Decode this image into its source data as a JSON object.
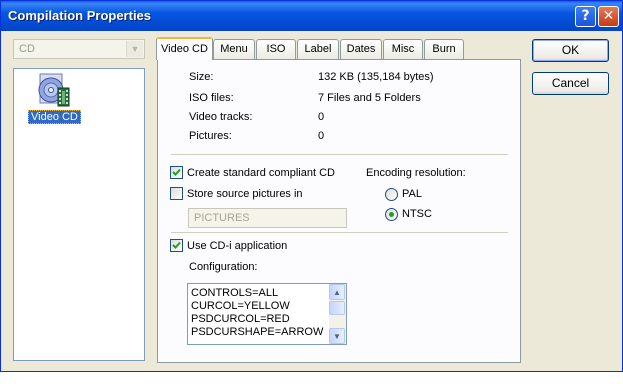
{
  "window": {
    "title": "Compilation Properties"
  },
  "titlebar": {
    "help_icon": "?",
    "close_icon": "✕"
  },
  "left": {
    "combo_value": "CD",
    "selected_item_label": "Video CD",
    "selected_item_icon": "video-cd-icon"
  },
  "tabs": [
    {
      "label": "Video CD",
      "active": true
    },
    {
      "label": "Menu"
    },
    {
      "label": "ISO"
    },
    {
      "label": "Label"
    },
    {
      "label": "Dates"
    },
    {
      "label": "Misc"
    },
    {
      "label": "Burn"
    }
  ],
  "info": [
    {
      "label": "Size:",
      "value": "132 KB (135,184 bytes)"
    },
    {
      "label": "ISO files:",
      "value": "7 Files and 5 Folders"
    },
    {
      "label": "Video tracks:",
      "value": "0"
    },
    {
      "label": "Pictures:",
      "value": "0"
    }
  ],
  "options": {
    "create_standard": {
      "label": "Create standard compliant CD",
      "checked": true
    },
    "store_source": {
      "label": "Store source pictures in",
      "checked": false
    },
    "pictures_folder": "PICTURES",
    "encoding_label": "Encoding resolution:",
    "encoding": [
      {
        "label": "PAL",
        "selected": false
      },
      {
        "label": "NTSC",
        "selected": true
      }
    ],
    "use_cdi": {
      "label": "Use CD-i application",
      "checked": true
    },
    "configuration_label": "Configuration:",
    "configuration_lines": [
      "CONTROLS=ALL",
      "CURCOL=YELLOW",
      "PSDCURCOL=RED",
      "PSDCURSHAPE=ARROW"
    ]
  },
  "buttons": {
    "ok": "OK",
    "cancel": "Cancel"
  },
  "colors": {
    "titlebar": "#0557e0",
    "dialog_bg": "#ece9d8",
    "selection": "#316ac5",
    "check": "#21a121"
  }
}
